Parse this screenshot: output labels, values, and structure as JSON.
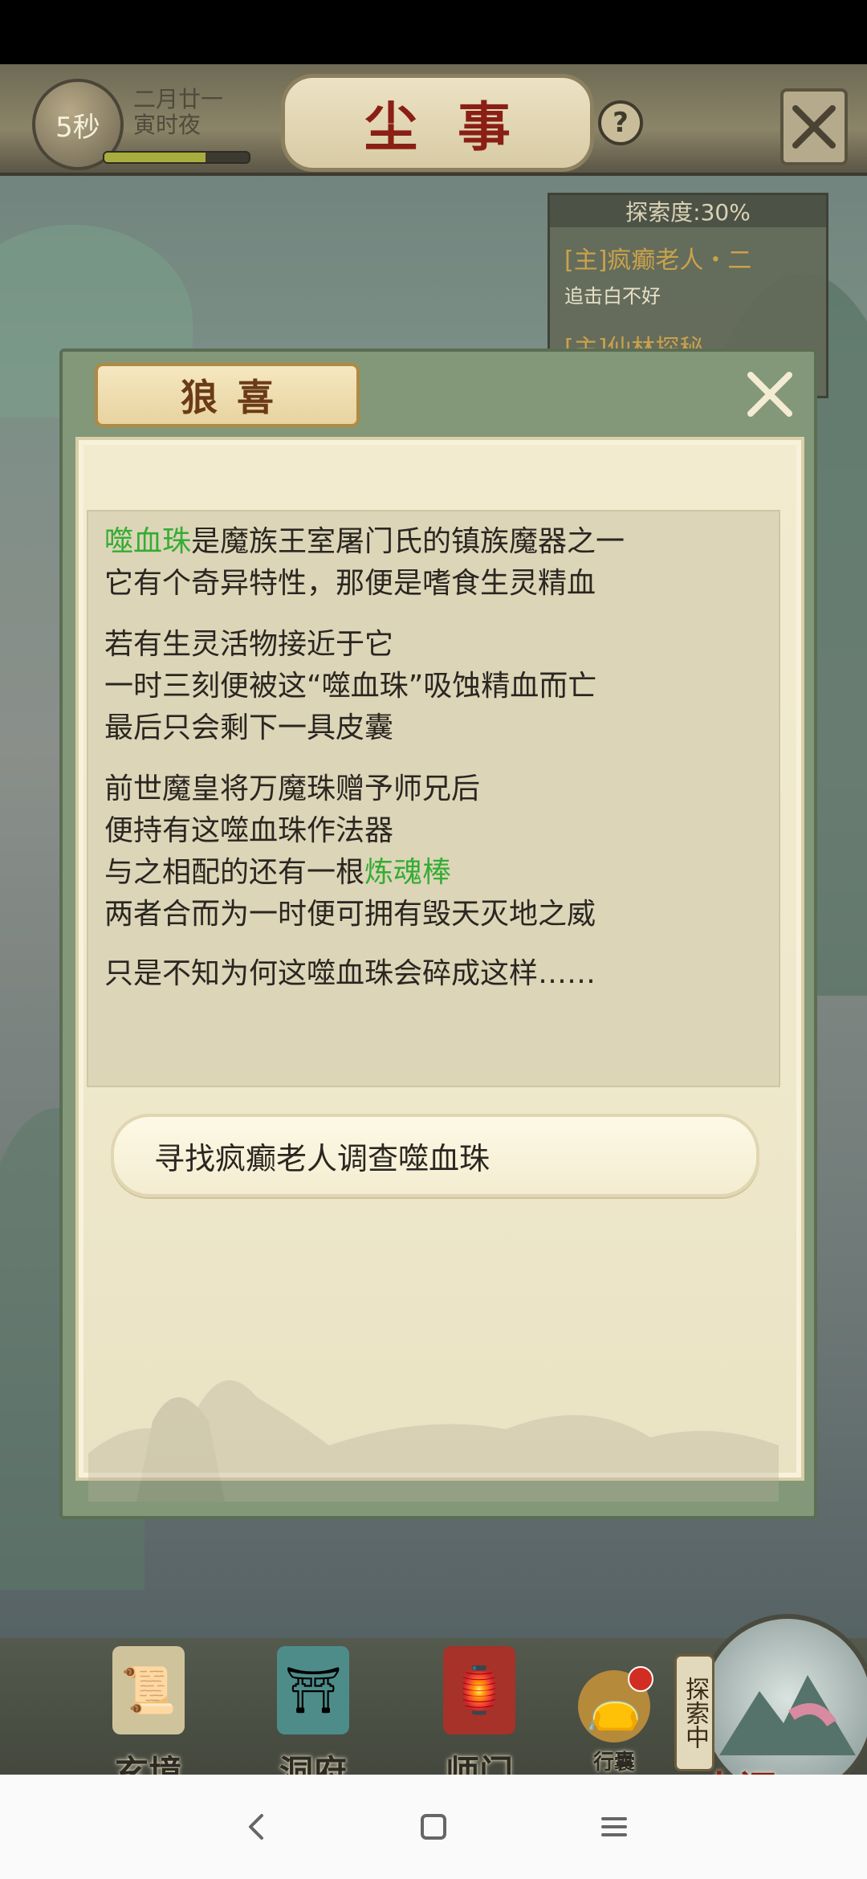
{
  "header": {
    "timer": "5秒",
    "date_line1": "二月廿一",
    "date_line2": "寅时夜",
    "day_progress": 0.7,
    "title": "尘事",
    "help": "?"
  },
  "quest_tracker": {
    "progress_label": "探索度:30%",
    "items": [
      {
        "title": "[主]疯癫老人・二",
        "subtitle": "追击白不好"
      },
      {
        "title": "[主]仙林探秘",
        "subtitle": ""
      }
    ]
  },
  "dialog": {
    "title": "狼喜",
    "paragraphs": {
      "p1_l1_hl": "噬血珠",
      "p1_l1_rest": "是魔族王室屠门氏的镇族魔器之一",
      "p1_l2": "它有个奇异特性，那便是嗜食生灵精血",
      "p2_l1": "若有生灵活物接近于它",
      "p2_l2": "一时三刻便被这“噬血珠”吸蚀精血而亡",
      "p2_l3": "最后只会剩下一具皮囊",
      "p3_l1": "前世魔皇将万魔珠赠予师兄后",
      "p3_l2": "便持有这噬血珠作法器",
      "p3_l3_pre": "与之相配的还有一根",
      "p3_l3_hl": "炼魂棒",
      "p3_l4": "两者合而为一时便可拥有毁天灭地之威",
      "p4_l1": "只是不知为何这噬血珠会碎成这样……"
    },
    "action_label": "寻找疯癫老人调查噬血珠",
    "colors": {
      "highlight": "#34ad34"
    }
  },
  "bottom_nav": {
    "items": [
      "玄境",
      "洞府",
      "师门",
      "行囊"
    ],
    "world_tag": "探索中",
    "world_label": "人间"
  },
  "system_nav": {
    "back_icon": "back-icon",
    "home_icon": "home-icon",
    "menu_icon": "menu-icon"
  }
}
